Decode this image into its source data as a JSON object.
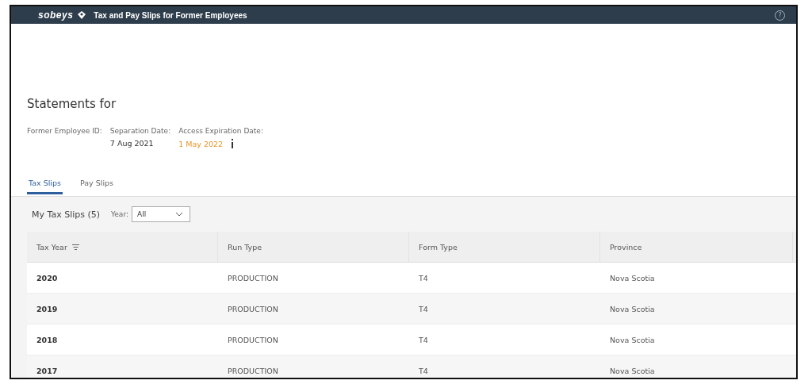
{
  "header": {
    "logo": "sobeys",
    "title": "Tax and Pay Slips for Former Employees",
    "help": "?"
  },
  "page_title": "Statements for",
  "fields": [
    {
      "label": "Former Employee ID:"
    },
    {
      "label": "Separation Date:",
      "value": "7 Aug 2021",
      "kind": "plain"
    },
    {
      "label": "Access Expiration Date:",
      "value": "1 May 2022",
      "kind": "warning"
    }
  ],
  "tabs": [
    {
      "label": "Tax Slips",
      "selected": true
    },
    {
      "label": "Pay Slips",
      "selected": false
    }
  ],
  "toolbar": {
    "title": "My Tax Slips (5)",
    "filter_label": "Year:",
    "filter_value": "All"
  },
  "table": {
    "columns": [
      {
        "label": "Tax Year",
        "sortable": true
      },
      {
        "label": "Run Type",
        "sortable": false
      },
      {
        "label": "Form Type",
        "sortable": false
      },
      {
        "label": "Province",
        "sortable": false
      }
    ],
    "rows": [
      [
        "2020",
        "PRODUCTION",
        "T4",
        "Nova Scotia"
      ],
      [
        "2019",
        "PRODUCTION",
        "T4",
        "Nova Scotia"
      ],
      [
        "2018",
        "PRODUCTION",
        "T4",
        "Nova Scotia"
      ],
      [
        "2017",
        "PRODUCTION",
        "T4",
        "Nova Scotia"
      ]
    ]
  }
}
